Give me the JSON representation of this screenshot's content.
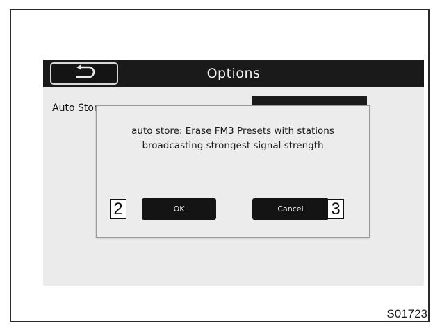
{
  "header": {
    "title": "Options",
    "back_icon": "back-arrow-icon"
  },
  "settings_row": {
    "label": "Auto Store"
  },
  "dialog": {
    "message": "auto store: Erase FM3 Presets with stations broadcasting strongest signal strength",
    "ok_label": "OK",
    "cancel_label": "Cancel"
  },
  "callouts": {
    "ok": "2",
    "cancel": "3"
  },
  "figure_code": "S01723",
  "colors": {
    "titlebar": "#1a1a1a",
    "screen_background": "#ebebeb",
    "dialog_background": "#ececec",
    "button": "#141414"
  }
}
